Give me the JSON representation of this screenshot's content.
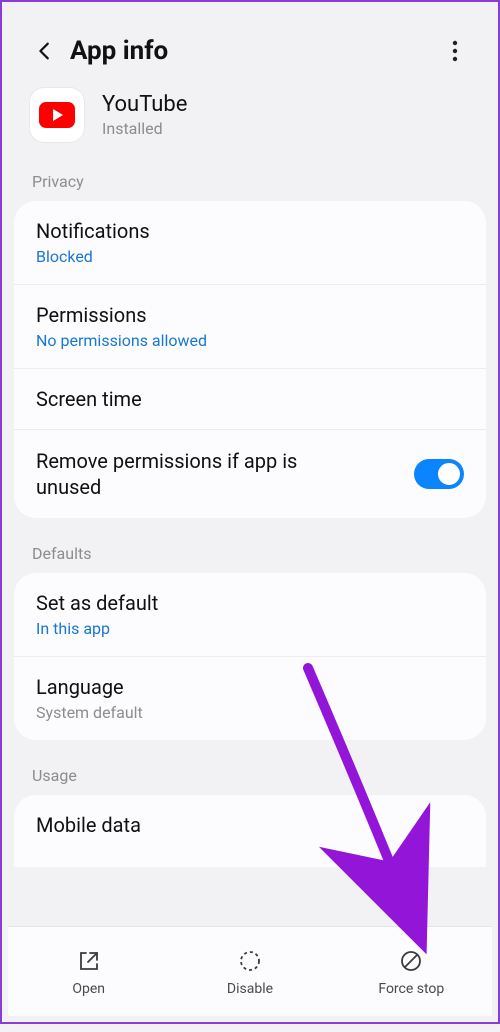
{
  "header": {
    "title": "App info"
  },
  "app": {
    "name": "YouTube",
    "status": "Installed"
  },
  "sections": {
    "privacy_label": "Privacy",
    "defaults_label": "Defaults",
    "usage_label": "Usage"
  },
  "privacy": {
    "notifications": {
      "title": "Notifications",
      "sub": "Blocked"
    },
    "permissions": {
      "title": "Permissions",
      "sub": "No permissions allowed"
    },
    "screen_time": {
      "title": "Screen time"
    },
    "remove_perms": {
      "title": "Remove permissions if app is unused",
      "toggle": true
    }
  },
  "defaults": {
    "set_default": {
      "title": "Set as default",
      "sub": "In this app"
    },
    "language": {
      "title": "Language",
      "sub": "System default"
    }
  },
  "usage": {
    "mobile_data": {
      "title": "Mobile data"
    }
  },
  "nav": {
    "open": "Open",
    "disable": "Disable",
    "force_stop": "Force stop"
  },
  "colors": {
    "accent_link": "#1877d3",
    "toggle_on": "#0a84ff",
    "arrow": "#9215d8"
  }
}
